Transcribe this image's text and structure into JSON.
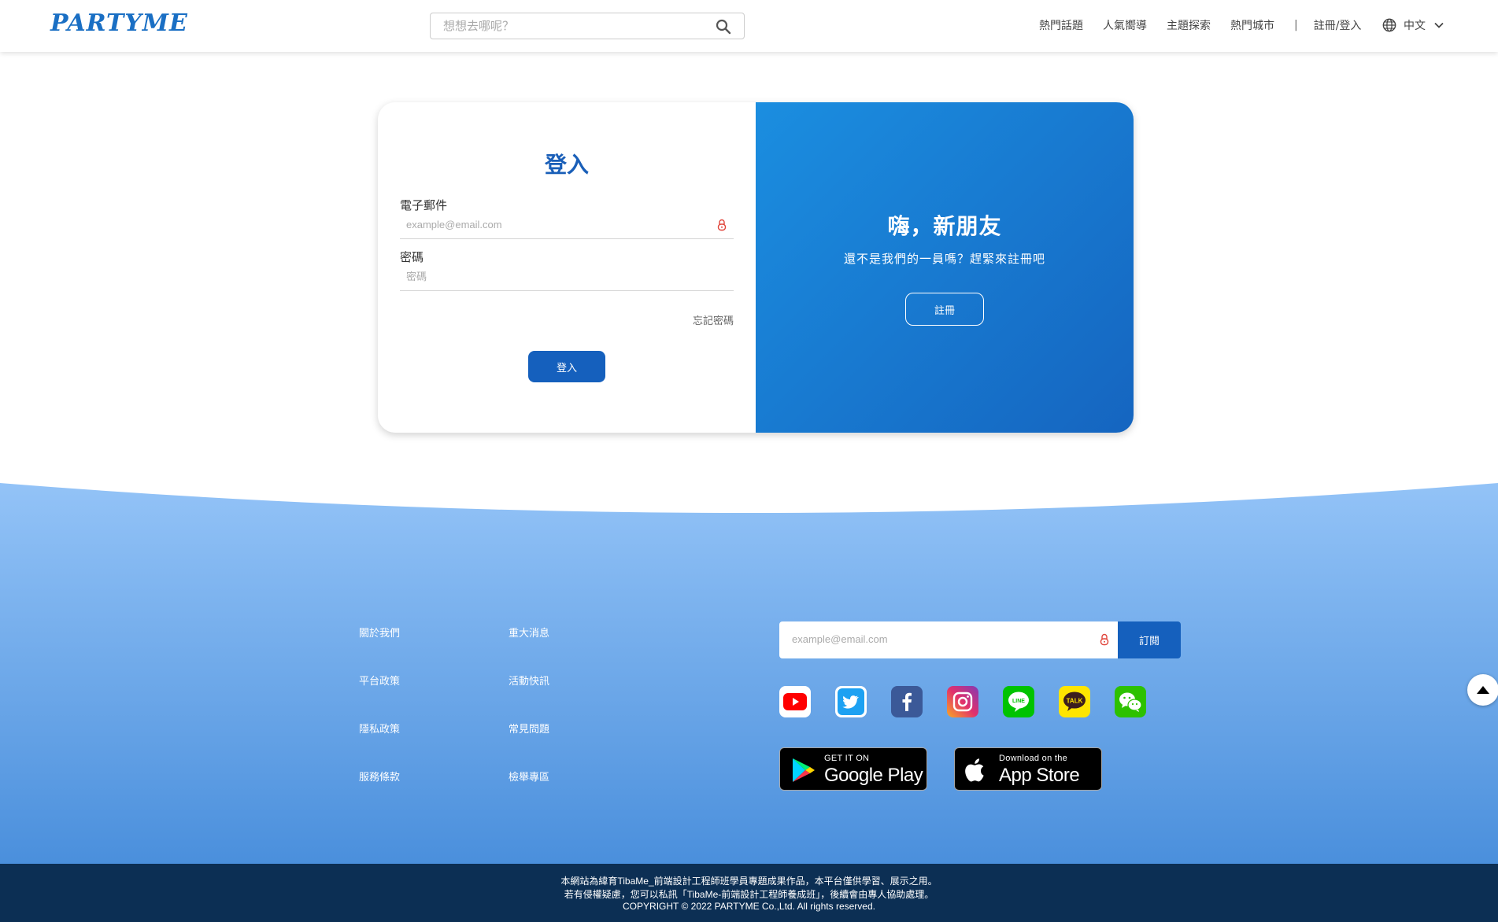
{
  "header": {
    "logo": "PARTYME",
    "search_placeholder": "想想去哪呢？",
    "nav": [
      "熱門話題",
      "人氣嚮導",
      "主題探索",
      "熱門城市"
    ],
    "separator": "|",
    "login_register": "註冊/登入",
    "language": "中文"
  },
  "login": {
    "title": "登入",
    "email_label": "電子郵件",
    "email_placeholder": "example@email.com",
    "password_label": "密碼",
    "password_placeholder": "密碼",
    "forgot": "忘記密碼",
    "submit": "登入"
  },
  "signup_panel": {
    "title": "嗨，新朋友",
    "subtitle": "還不是我們的一員嗎？趕緊來註冊吧",
    "button": "註冊"
  },
  "footer": {
    "links_col1": [
      "關於我們",
      "平台政策",
      "隱私政策",
      "服務條款"
    ],
    "links_col2": [
      "重大消息",
      "活動快訊",
      "常見問題",
      "檢舉專區"
    ],
    "subscribe_placeholder": "example@email.com",
    "subscribe_button": "訂閱",
    "socials": [
      {
        "icon": "youtube-icon",
        "color": "#ff0000"
      },
      {
        "icon": "twitter-icon",
        "color": "#1da1f2"
      },
      {
        "icon": "facebook-icon",
        "color": "#3b5998"
      },
      {
        "icon": "instagram-icon",
        "color": "#c13584"
      },
      {
        "icon": "line-icon",
        "color": "#00c300"
      },
      {
        "icon": "kakaotalk-icon",
        "color": "#fee500",
        "text": "TALK"
      },
      {
        "icon": "wechat-icon",
        "color": "#2dc100"
      }
    ],
    "google_play": {
      "small": "GET IT ON",
      "big": "Google Play"
    },
    "app_store": {
      "small": "Download on the",
      "big": "App Store"
    },
    "copyright_lines": [
      "本網站為緯育TibaMe_前端設計工程師班學員專題成果作品，本平台僅供學習、展示之用。",
      "若有侵權疑慮，您可以私訊「TibaMe-前端設計工程師養成班」，後續會由專人協助處理。",
      "COPYRIGHT © 2022 PARTYME Co.,Ltd. All rights reserved."
    ]
  },
  "colors": {
    "primary": "#1560bd",
    "panel_gradient_start": "#1b8ee0",
    "panel_gradient_end": "#1565c0",
    "footer_light": "#8fc0f5",
    "footer_dark": "#4a8fdc",
    "bottom_bar": "#0c2f54"
  }
}
